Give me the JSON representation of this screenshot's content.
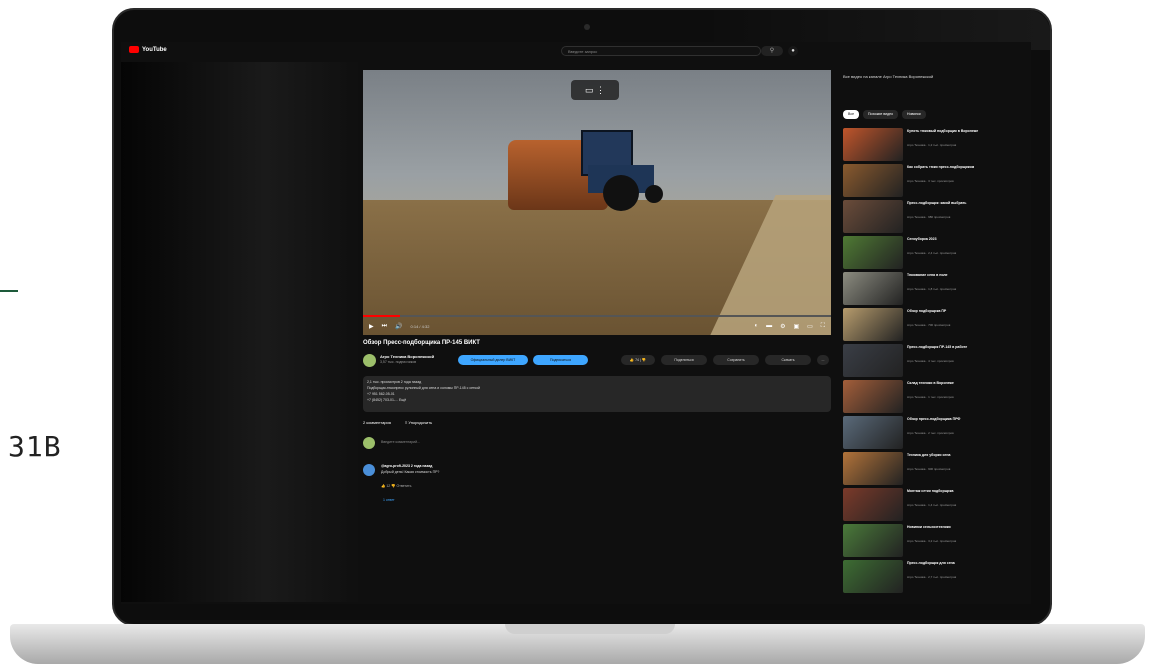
{
  "side": {
    "label": "31B"
  },
  "masthead": {
    "logo_text": "YouTube",
    "search_placeholder": "Введите запрос",
    "search_icon": "search-icon",
    "mic_icon": "mic-icon"
  },
  "player": {
    "time": "0:14 / 4:32",
    "progress_fraction": 0.08,
    "miniplayer_icons": [
      "cast-icon",
      "more-icon"
    ]
  },
  "video": {
    "title": "Обзор Пресс-подборщика ПР-145 ВИКТ",
    "channel_name": "Агро Техника Воронежской",
    "channel_subs": "3,57 тыс. подписчиков",
    "subscribe_label": "Официальный дилер ВИКТ",
    "join_label": "Подписаться",
    "likes": "74",
    "share_label": "Поделиться",
    "save_label": "Сохранить",
    "clip_label": "Скачать",
    "more_label": "..."
  },
  "description": {
    "lines": [
      "2,1 тыс. просмотров  2 года назад",
      "Подборщик-тюкопресс рулонный для сена и соломы ПР-145 с сеткой",
      "+7 951 562-05-01",
      "+7 (8452) 703-01-... Ещё"
    ]
  },
  "comments": {
    "count_label": "2 комментария",
    "sort_label": "Упорядочить",
    "add_placeholder": "Введите комментарий...",
    "items": [
      {
        "author": "@agro-profi-2023  2 года назад",
        "text": "Добрый день! Какая стоимость ПР?",
        "actions": "👍 12   👎   Ответить"
      }
    ],
    "replies_label": "1 ответ"
  },
  "sidebar": {
    "heading": "Все видео на канале Агро Техника Воронежской",
    "chips": [
      "Все",
      "Похожие видео",
      "Новинки"
    ],
    "recommendations": [
      {
        "title": "Купить тюковый подборщик в Воронеже",
        "meta": "Агро Техника · 1,2 тыс. просмотров",
        "color": "#c0552b"
      },
      {
        "title": "Как собрать тюки пресс-подборщиком",
        "meta": "Агро Техника · 3 тыс. просмотров",
        "color": "#8a5a2e"
      },
      {
        "title": "Пресс-подборщик: какой выбрать",
        "meta": "Агро Техника · 980 просмотров",
        "color": "#6b4c3a"
      },
      {
        "title": "Сеноуборка 2023",
        "meta": "Агро Техника · 2,4 тыс. просмотров",
        "color": "#4f7a34"
      },
      {
        "title": "Тюкование сена в поле",
        "meta": "Агро Техника · 1,8 тыс. просмотров",
        "color": "#8c8c80"
      },
      {
        "title": "Обзор подборщика ПР",
        "meta": "Агро Техника · 700 просмотров",
        "color": "#b79c6d"
      },
      {
        "title": "Пресс-подборщик ПР-145 в работе",
        "meta": "Агро Техника · 4 тыс. просмотров",
        "color": "#3a3e46"
      },
      {
        "title": "Склад техники в Воронеже",
        "meta": "Агро Техника · 1 тыс. просмотров",
        "color": "#a35e3a"
      },
      {
        "title": "Обзор пресс-подборщика ПРФ",
        "meta": "Агро Техника · 2 тыс. просмотров",
        "color": "#5a6a7a"
      },
      {
        "title": "Техника для уборки сена",
        "meta": "Агро Техника · 900 просмотров",
        "color": "#b2733a"
      },
      {
        "title": "Монтаж сетки подборщика",
        "meta": "Агро Техника · 1,4 тыс. просмотров",
        "color": "#7b3a2a"
      },
      {
        "title": "Новинки сельхозтехники",
        "meta": "Агро Техника · 3,2 тыс. просмотров",
        "color": "#4a7a3a"
      },
      {
        "title": "Пресс-подборщик для сена",
        "meta": "Агро Техника · 2,7 тыс. просмотров",
        "color": "#3d6d33"
      }
    ]
  }
}
